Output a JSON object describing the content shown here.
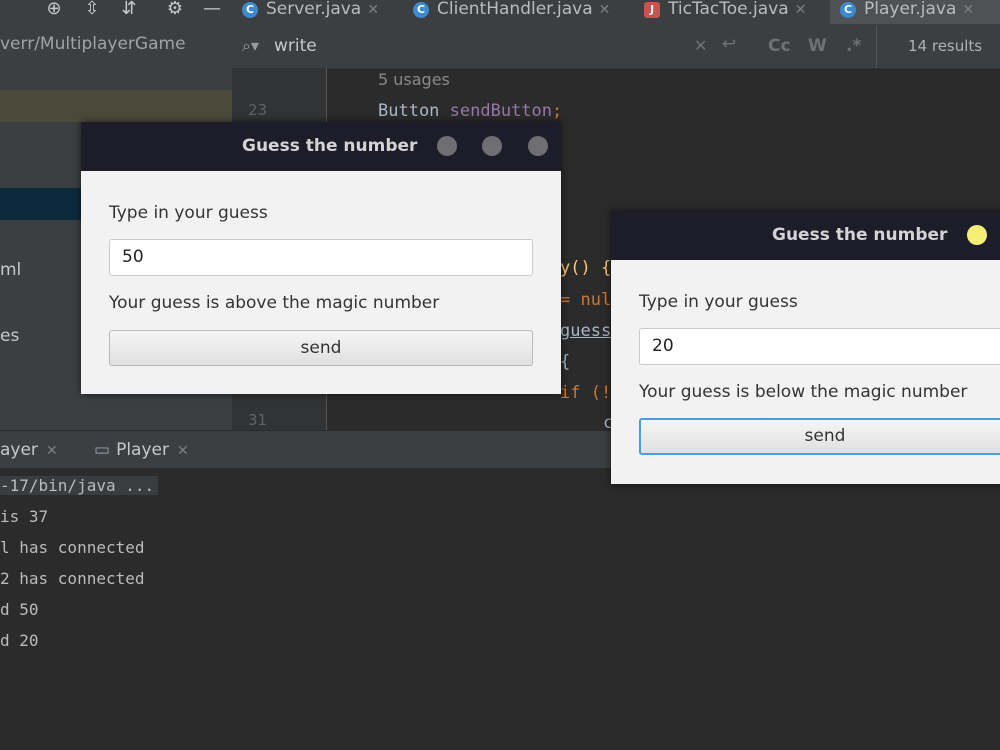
{
  "ide": {
    "tabs": [
      {
        "label": "Server.java"
      },
      {
        "label": "ClientHandler.java"
      },
      {
        "label": "TicTacToe.java"
      },
      {
        "label": "Player.java"
      }
    ],
    "project_path": "verr/MultiplayerGame",
    "project_items": [
      "ml",
      "es"
    ],
    "search": {
      "query": "write",
      "results": "14 results",
      "opt_case": "Cc",
      "opt_words": "W",
      "opt_regex": ".*"
    },
    "code": {
      "usages": "5 usages",
      "line23": "23",
      "line23_text_kw": "Button ",
      "line23_text_field": "sendButton",
      "line23_text_end": ";",
      "line31": "31",
      "frag1": "y() {",
      "frag2": "= nul",
      "frag3": "guess",
      "frag4": "{",
      "frag5": "if (!",
      "frag6": "c"
    },
    "run_tabs": [
      {
        "label": "ayer"
      },
      {
        "label": "Player"
      }
    ],
    "console": [
      "-17/bin/java ...",
      " is 37",
      "l has connected",
      "2 has connected",
      "d 50",
      "d 20"
    ]
  },
  "dialog1": {
    "title": "Guess the number",
    "prompt": "Type in your guess",
    "guess_value": "50",
    "feedback": "Your guess is above the magic number",
    "button": "send"
  },
  "dialog2": {
    "title": "Guess the number",
    "prompt": "Type in your guess",
    "guess_value": "20",
    "feedback": "Your guess is below the magic number",
    "button": "send"
  },
  "colors": {
    "accent": "#4a9fd8",
    "title_bar": "#1d1d2a",
    "minimize_highlight": "#f5f075"
  }
}
